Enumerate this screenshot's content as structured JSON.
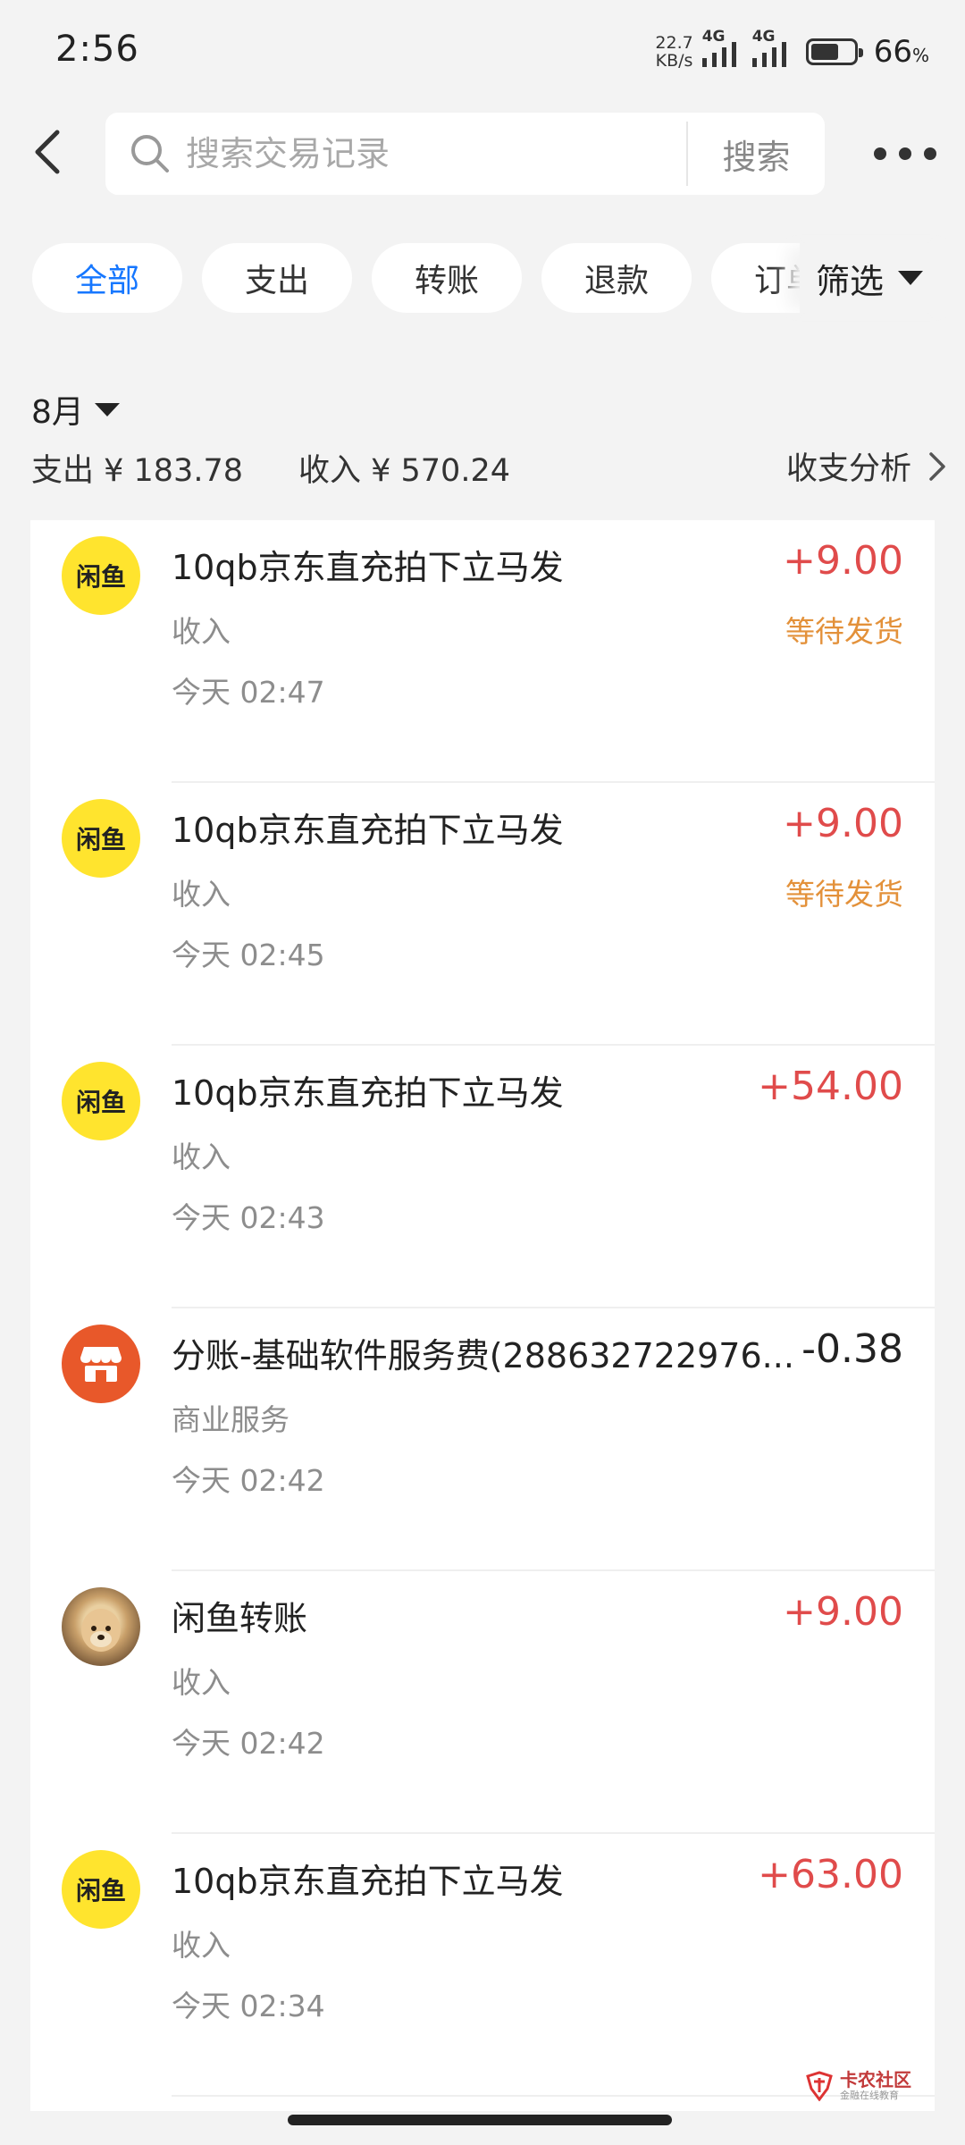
{
  "status_bar": {
    "time": "2:56",
    "net_speed_value": "22.7",
    "net_speed_unit": "KB/s",
    "network1": "4G",
    "network2": "4G",
    "battery_level": 0.66,
    "battery_percent": "66",
    "battery_percent_sign": "%"
  },
  "header": {
    "search_placeholder": "搜索交易记录",
    "search_button": "搜索"
  },
  "tabs": [
    {
      "label": "全部",
      "active": true
    },
    {
      "label": "支出"
    },
    {
      "label": "转账"
    },
    {
      "label": "退款"
    },
    {
      "label": "订单"
    }
  ],
  "filter_label": "筛选",
  "month": {
    "label": "8月",
    "expense": "支出 ¥ 183.78",
    "income": "收入 ¥ 570.24",
    "analysis": "收支分析"
  },
  "transactions": [
    {
      "icon": "xianyu-logo-icon",
      "title": "10qb京东直充拍下立马发",
      "amount": "+9.00",
      "category": "收入",
      "status": "等待发货",
      "time": "今天 02:47"
    },
    {
      "icon": "xianyu-logo-icon",
      "title": "10qb京东直充拍下立马发",
      "amount": "+9.00",
      "category": "收入",
      "status": "等待发货",
      "time": "今天 02:45"
    },
    {
      "icon": "xianyu-logo-icon",
      "title": "10qb京东直充拍下立马发",
      "amount": "+54.00",
      "category": "收入",
      "status": "",
      "time": "今天 02:43"
    },
    {
      "icon": "shop-icon",
      "title": "分账-基础软件服务费(288632722976...",
      "amount": "-0.38",
      "category": "商业服务",
      "status": "",
      "time": "今天 02:42"
    },
    {
      "icon": "dog-avatar",
      "title": "闲鱼转账",
      "amount": "+9.00",
      "category": "收入",
      "status": "",
      "time": "今天 02:42"
    },
    {
      "icon": "xianyu-logo-icon",
      "title": "10qb京东直充拍下立马发",
      "amount": "+63.00",
      "category": "收入",
      "status": "",
      "time": "今天 02:34"
    }
  ],
  "colors": {
    "accent": "#1677ff",
    "income": "#e04b4b",
    "pending": "#e3913a",
    "xianyu_yellow": "#ffe42e",
    "shop_orange": "#e8582a"
  },
  "watermark": {
    "main": "卡农社区",
    "sub": "金融在线教育"
  }
}
